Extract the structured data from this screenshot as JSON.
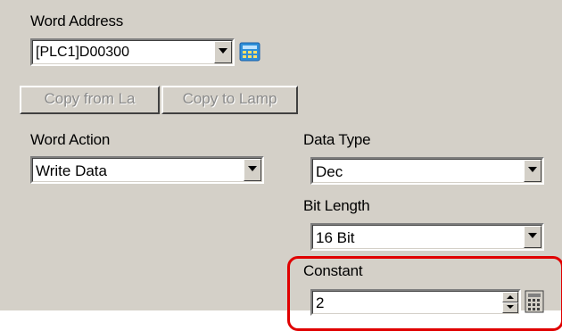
{
  "word_address": {
    "label": "Word Address",
    "value": "[PLC1]D00300"
  },
  "buttons": {
    "copy_from": "Copy  from La",
    "copy_to": "Copy to Lamp"
  },
  "word_action": {
    "label": "Word Action",
    "value": "Write Data"
  },
  "data_type": {
    "label": "Data Type",
    "value": "Dec"
  },
  "bit_length": {
    "label": "Bit Length",
    "value": "16 Bit"
  },
  "constant": {
    "label": "Constant",
    "value": "2"
  },
  "colors": {
    "panel": "#d4d0c8",
    "highlight": "#e00000"
  }
}
